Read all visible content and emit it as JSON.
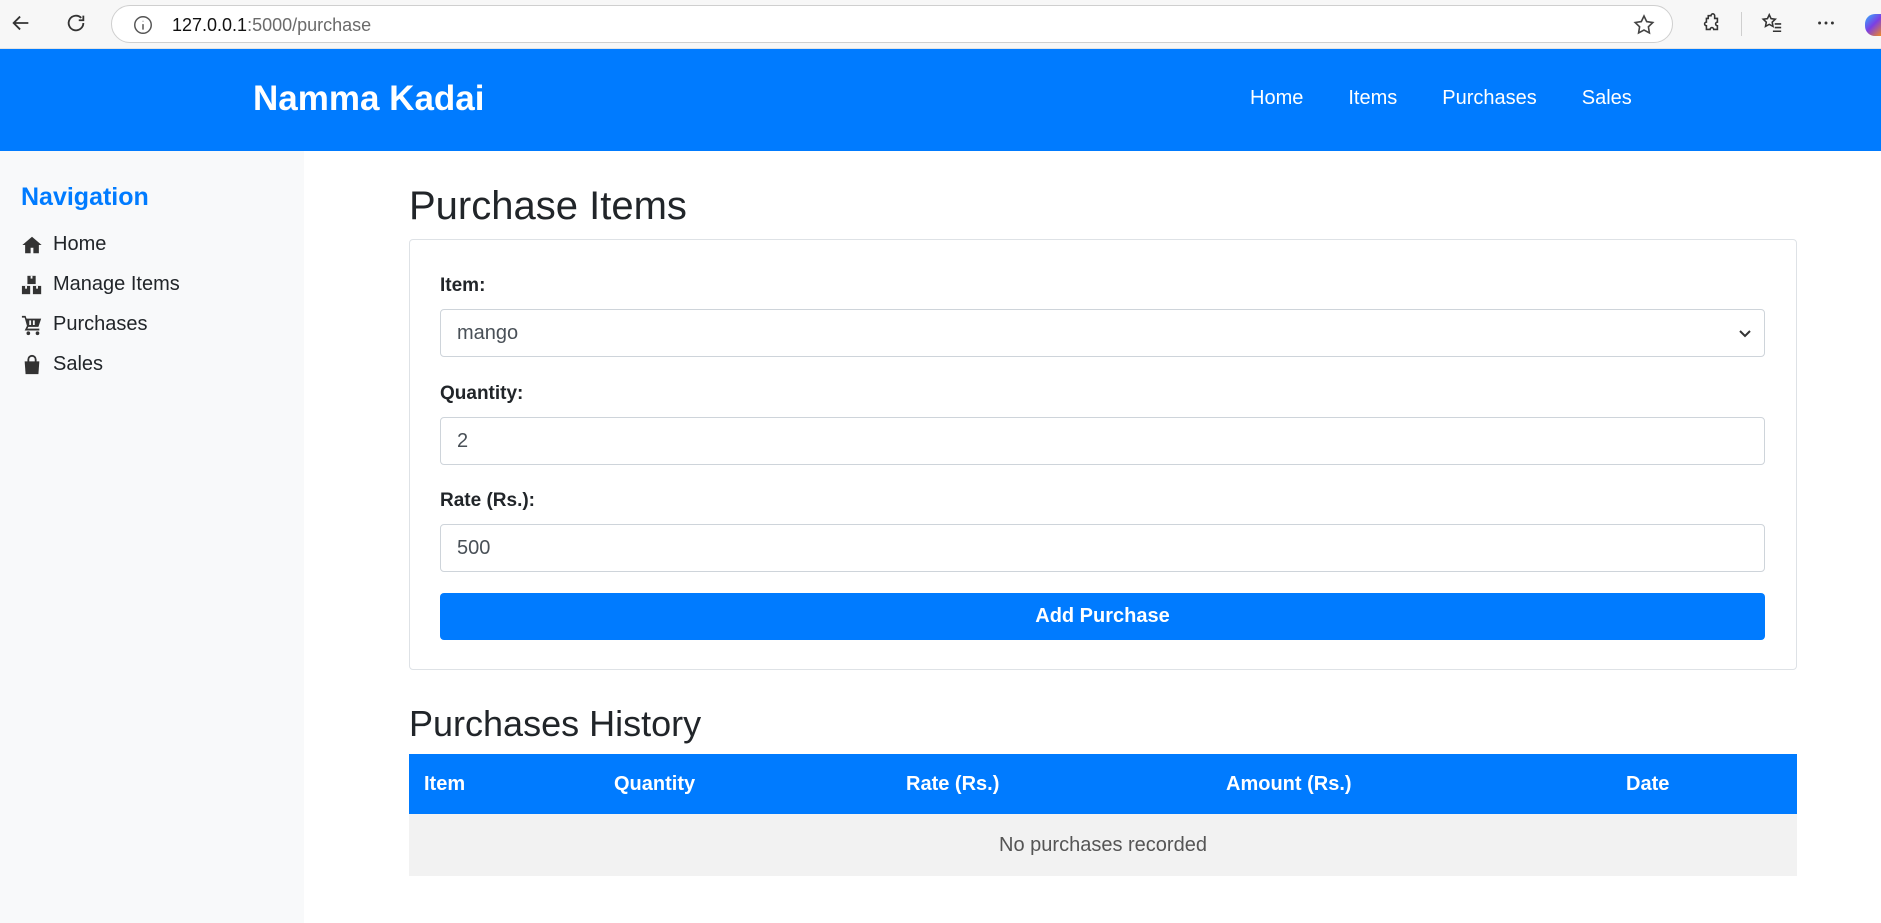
{
  "browser": {
    "url_host": "127.0.0.1",
    "url_path": ":5000/purchase"
  },
  "navbar": {
    "brand": "Namma Kadai",
    "links": [
      "Home",
      "Items",
      "Purchases",
      "Sales"
    ]
  },
  "sidebar": {
    "title": "Navigation",
    "items": [
      {
        "label": "Home",
        "icon": "home-icon"
      },
      {
        "label": "Manage Items",
        "icon": "boxes-icon"
      },
      {
        "label": "Purchases",
        "icon": "cart-icon"
      },
      {
        "label": "Sales",
        "icon": "shopping-bag-icon"
      }
    ]
  },
  "main": {
    "title": "Purchase Items",
    "form": {
      "item_label": "Item:",
      "item_value": "mango",
      "quantity_label": "Quantity:",
      "quantity_value": "2",
      "rate_label": "Rate (Rs.):",
      "rate_value": "500",
      "submit_label": "Add Purchase"
    },
    "history": {
      "title": "Purchases History",
      "columns": [
        "Item",
        "Quantity",
        "Rate (Rs.)",
        "Amount (Rs.)",
        "Date"
      ],
      "empty_text": "No purchases recorded"
    }
  },
  "colors": {
    "primary": "#007bff",
    "sidebar_bg": "#f8f9fa",
    "row_bg": "#f2f2f2"
  }
}
